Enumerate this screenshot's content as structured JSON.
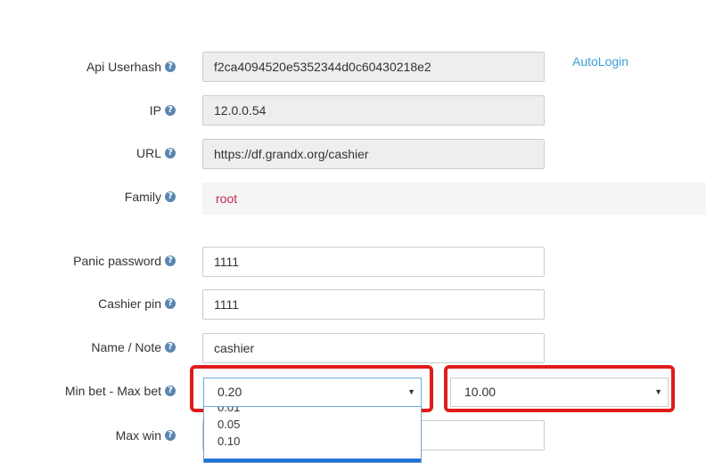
{
  "autologin_label": "AutoLogin",
  "fields": {
    "api_userhash": {
      "label": "Api Userhash",
      "value": "f2ca4094520e5352344d0c60430218e2"
    },
    "ip": {
      "label": "IP",
      "value": "12.0.0.54"
    },
    "url": {
      "label": "URL",
      "value": "https://df.grandx.org/cashier"
    },
    "family": {
      "label": "Family",
      "value": "root"
    },
    "panic_password": {
      "label": "Panic password",
      "value": "1111"
    },
    "cashier_pin": {
      "label": "Cashier pin",
      "value": "1111"
    },
    "name_note": {
      "label": "Name / Note",
      "value": "cashier"
    },
    "bet": {
      "label": "Min bet - Max bet",
      "min_selected": "0.20",
      "max_selected": "10.00"
    },
    "max_win": {
      "label": "Max win",
      "value": ""
    }
  },
  "min_bet_options": [
    "0.01",
    "0.05",
    "0.10"
  ],
  "help_glyph": "?",
  "caret_glyph": "▼",
  "icons": {
    "help": "question-circle-icon",
    "caret": "caret-down-icon"
  },
  "colors": {
    "link": "#3a9fd6",
    "family_value": "#c7254e",
    "highlight": "#e01b1b",
    "help_icon": "#5a86b0",
    "readonly_bg": "#eeeeee"
  }
}
